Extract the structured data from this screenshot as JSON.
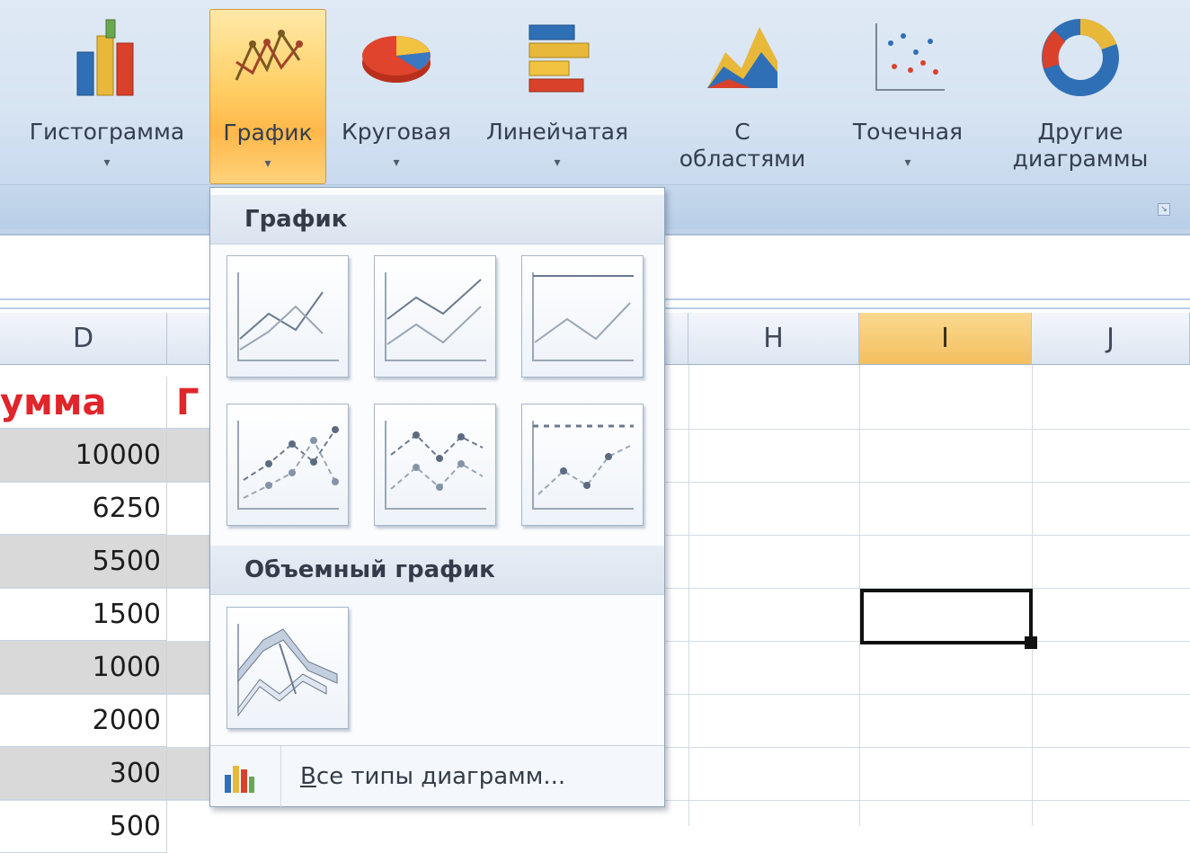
{
  "ribbon": {
    "buttons": [
      {
        "label": "Гистограмма",
        "icon": "column-chart-icon"
      },
      {
        "label": "График",
        "icon": "line-chart-icon"
      },
      {
        "label": "Круговая",
        "icon": "pie-chart-icon"
      },
      {
        "label": "Линейчатая",
        "icon": "bar-chart-icon"
      },
      {
        "label": "С",
        "label2": "областями",
        "icon": "area-chart-icon"
      },
      {
        "label": "Точечная",
        "icon": "scatter-chart-icon"
      },
      {
        "label": "Другие",
        "label2": "диаграммы",
        "icon": "doughnut-chart-icon"
      }
    ],
    "arrow": "▾"
  },
  "sheet": {
    "columns": [
      "D",
      "H",
      "I",
      "J"
    ],
    "header_cells": {
      "D": "умма",
      "E": "Г"
    },
    "d_values": [
      "10000",
      "6250",
      "5500",
      "1500",
      "1000",
      "2000",
      "300",
      "500"
    ]
  },
  "dropdown": {
    "section1_title": "График",
    "section2_title": "Объемный график",
    "footer_label_first": "В",
    "footer_label_rest": "се типы диаграмм..."
  },
  "colors": {
    "accent_orange": "#ffc35a",
    "ribbon_blue": "#d7e4f2",
    "header_red": "#e0252b"
  }
}
